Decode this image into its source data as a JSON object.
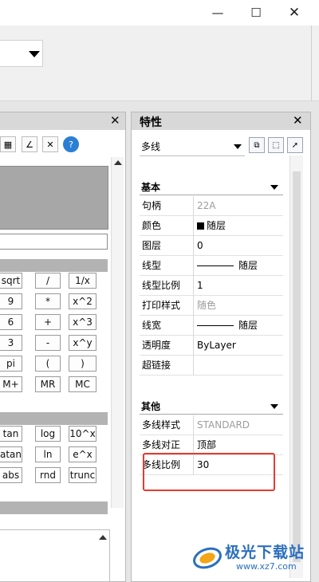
{
  "window": {
    "minimize_icon": "—",
    "maximize_icon": "☐",
    "close_icon": "✕"
  },
  "calc": {
    "close_icon": "✕",
    "tools": [
      "measure-icon",
      "angle-icon",
      "clear-icon",
      "help-icon"
    ],
    "tool_glyphs": [
      "▦",
      "∠",
      "✕",
      "?"
    ],
    "keys_row1": [
      [
        "sqrt",
        "/",
        "1/x"
      ],
      [
        "9",
        "*",
        "x^2"
      ],
      [
        "6",
        "+",
        "x^3"
      ],
      [
        "3",
        "-",
        "x^y"
      ],
      [
        "pi",
        "(",
        ")"
      ],
      [
        "M+",
        "MR",
        "MC"
      ]
    ],
    "keys_row2": [
      [
        "tan",
        "log",
        "10^x"
      ],
      [
        "atan",
        "ln",
        "e^x"
      ],
      [
        "abs",
        "rnd",
        "trunc"
      ]
    ]
  },
  "properties": {
    "title": "特性",
    "close_icon": "✕",
    "object_type": "多线",
    "basic": {
      "label": "基本",
      "rows": [
        {
          "name": "句柄",
          "value": "22A",
          "grey": true
        },
        {
          "name": "颜色",
          "value": "随层",
          "swatch": true
        },
        {
          "name": "图层",
          "value": "0"
        },
        {
          "name": "线型",
          "value": "随层",
          "line": true
        },
        {
          "name": "线型比例",
          "value": "1"
        },
        {
          "name": "打印样式",
          "value": "随色",
          "grey": true
        },
        {
          "name": "线宽",
          "value": "随层",
          "line": true
        },
        {
          "name": "透明度",
          "value": "ByLayer"
        },
        {
          "name": "超链接",
          "value": ""
        }
      ]
    },
    "other": {
      "label": "其他",
      "rows": [
        {
          "name": "多线样式",
          "value": "STANDARD",
          "grey": true
        },
        {
          "name": "多线对正",
          "value": "顶部"
        },
        {
          "name": "多线比例",
          "value": "30"
        }
      ]
    }
  },
  "watermark": {
    "title": "极光下载站",
    "url": "www.xz7.com"
  },
  "colors": {
    "highlight": "#e43b33",
    "brand": "#2b6fbf"
  }
}
